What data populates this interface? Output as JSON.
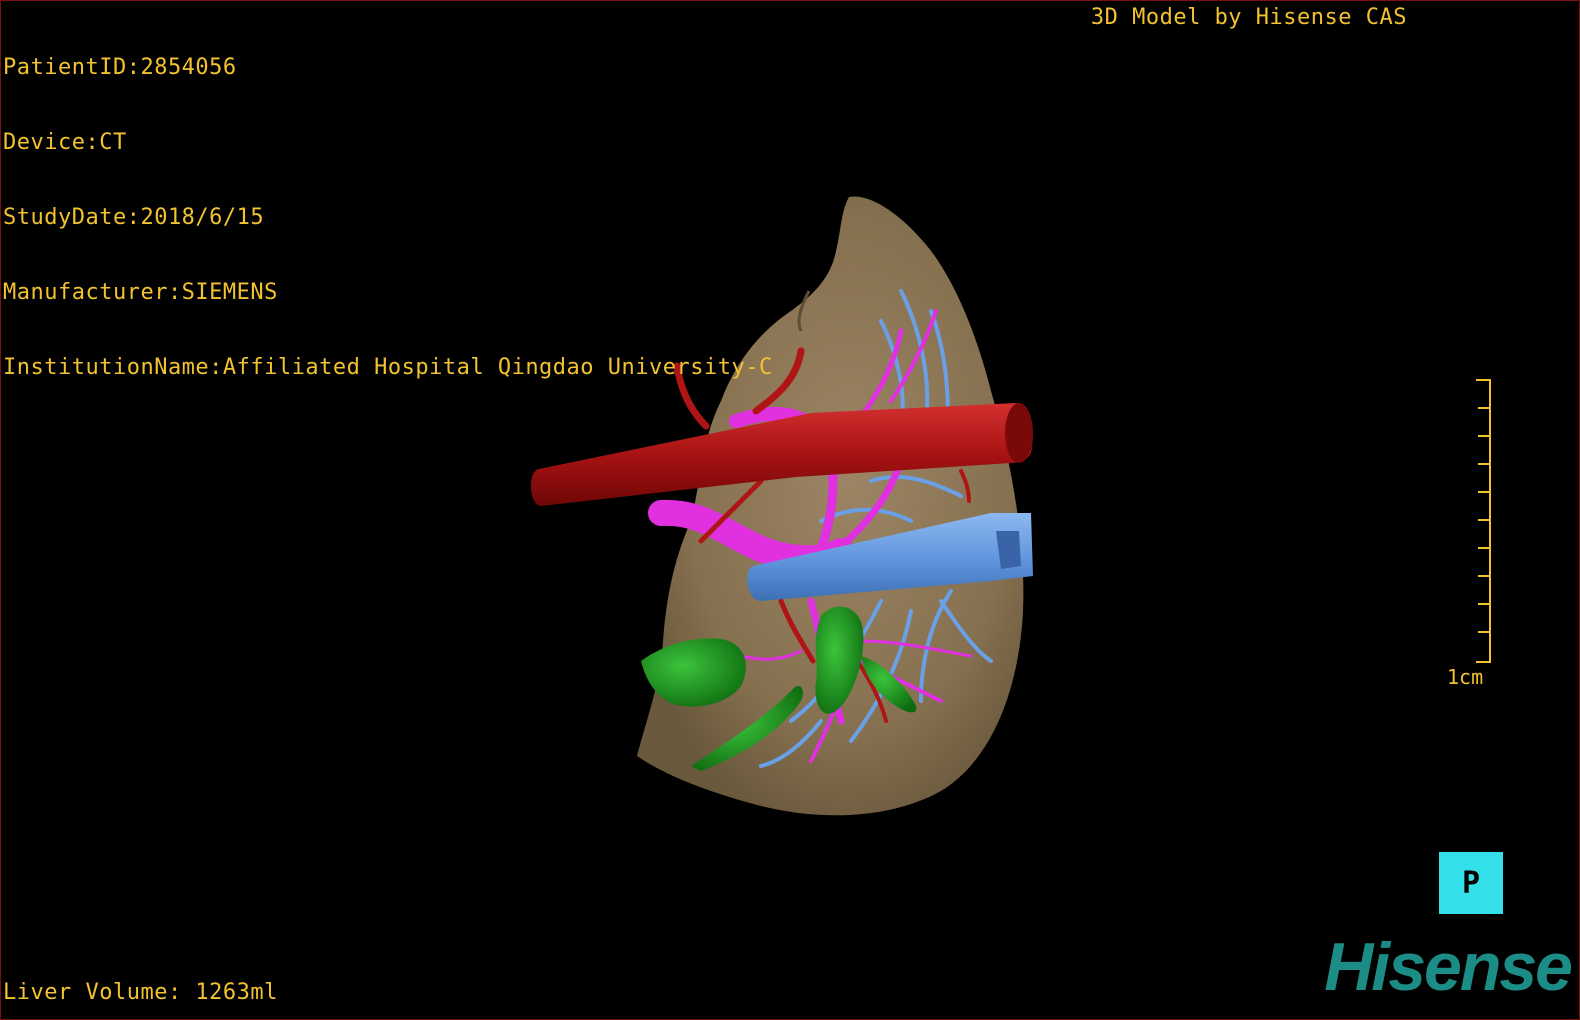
{
  "patient_info": {
    "patient_id": "PatientID:2854056",
    "device": "Device:CT",
    "study_date": "StudyDate:2018/6/15",
    "manufacturer": "Manufacturer:SIEMENS",
    "institution": "InstitutionName:Affiliated Hospital Qingdao University-C"
  },
  "credit": "3D Model by Hisense CAS",
  "liver_volume": "Liver Volume: 1263ml",
  "scale": {
    "label": "1cm"
  },
  "orientation_marker": "P",
  "logo": "Hisense",
  "colors": {
    "overlay_text": "#f2c230",
    "liver": "#8b7556",
    "artery": "#b01515",
    "portal_vein": "#e030e0",
    "hepatic_vein": "#5f94dc",
    "lesion": "#1e8a1e",
    "orientation_button": "#33e0ea",
    "logo": "#1c8c86"
  }
}
